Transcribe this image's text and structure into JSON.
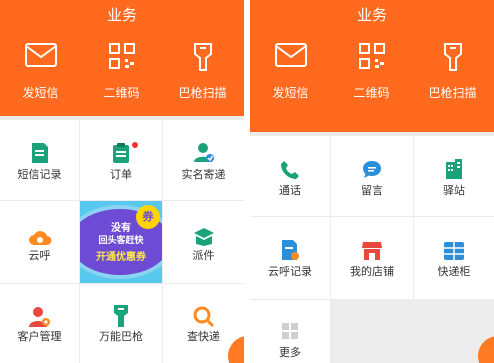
{
  "left": {
    "title": "业务",
    "header_items": [
      {
        "label": "发短信",
        "icon": "envelope-icon"
      },
      {
        "label": "二维码",
        "icon": "qr-code-icon"
      },
      {
        "label": "巴枪扫描",
        "icon": "barcode-scanner-icon"
      }
    ],
    "grid": [
      {
        "label": "短信记录",
        "icon": "sms-record-icon"
      },
      {
        "label": "订单",
        "icon": "order-clipboard-icon",
        "has_badge": true
      },
      {
        "label": "实名寄递",
        "icon": "verified-user-icon"
      },
      {
        "label": "云呼",
        "icon": "cloud-phone-icon"
      },
      {
        "label": "",
        "icon": "promo-banner"
      },
      {
        "label": "派件",
        "icon": "dispatch-box-icon"
      },
      {
        "label": "客户管理",
        "icon": "customer-gear-icon"
      },
      {
        "label": "万能巴枪",
        "icon": "universal-scanner-icon"
      },
      {
        "label": "查快递",
        "icon": "search-package-icon"
      }
    ],
    "promo": {
      "line1": "没有",
      "line2": "回头客赶快",
      "line3": "开通优惠券",
      "coupon": "券"
    }
  },
  "right": {
    "title": "业务",
    "header_items": [
      {
        "label": "发短信",
        "icon": "envelope-icon"
      },
      {
        "label": "二维码",
        "icon": "qr-code-icon"
      },
      {
        "label": "巴枪扫描",
        "icon": "barcode-scanner-icon"
      }
    ],
    "grid": [
      {
        "label": "通话",
        "icon": "phone-icon"
      },
      {
        "label": "留言",
        "icon": "message-bubble-icon"
      },
      {
        "label": "驿站",
        "icon": "station-building-icon"
      },
      {
        "label": "云呼记录",
        "icon": "cloud-call-record-icon"
      },
      {
        "label": "我的店铺",
        "icon": "shop-icon"
      },
      {
        "label": "快递柜",
        "icon": "locker-icon"
      },
      {
        "label": "更多",
        "icon": "more-grid-icon"
      }
    ]
  },
  "colors": {
    "brand_orange": "#ff6a1f",
    "green_icon": "#1aa37a",
    "blue_icon": "#2b8fd9",
    "red_icon": "#e8483d",
    "gray_bg": "#ececec"
  }
}
